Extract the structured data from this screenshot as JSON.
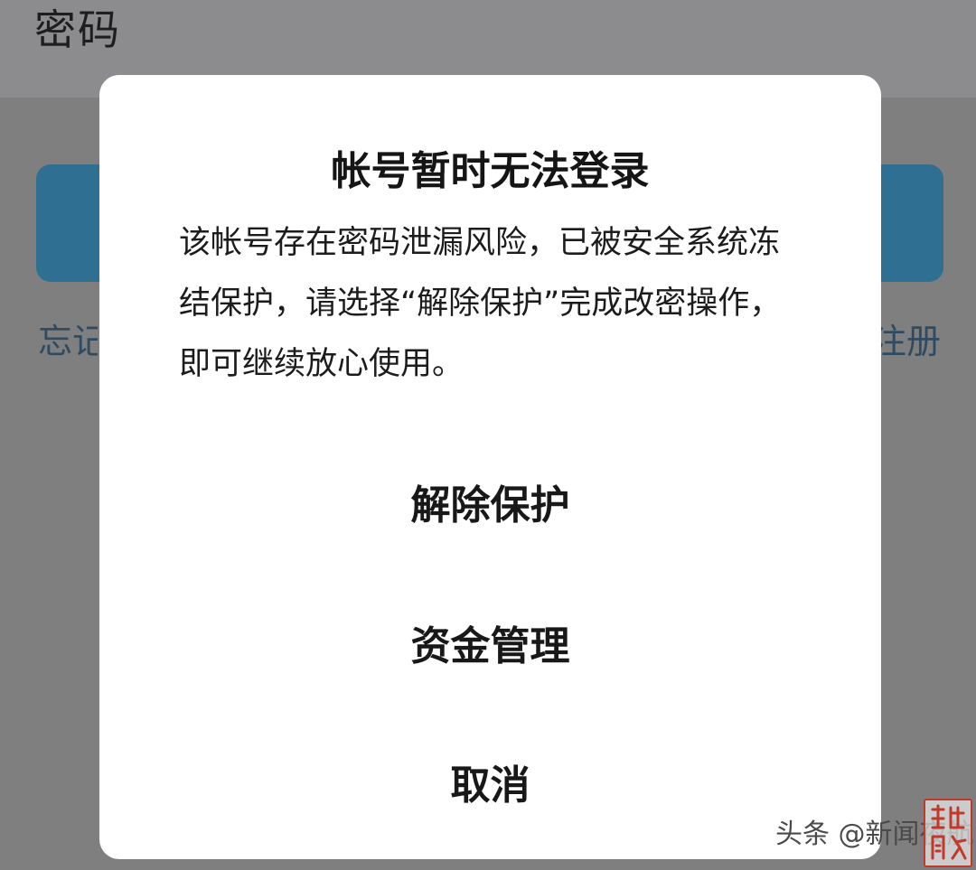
{
  "background": {
    "password_label": "密码",
    "forgot_link": "忘记",
    "register_link": "注册"
  },
  "dialog": {
    "title": "帐号暂时无法登录",
    "message": "该帐号存在密码泄漏风险，已被安全系统冻结保护，请选择“解除保护”完成改密操作，即可继续放心使用。",
    "actions": [
      {
        "label": "解除保护"
      },
      {
        "label": "资金管理"
      },
      {
        "label": "取消"
      }
    ]
  },
  "watermark": {
    "text": "头条 @新闻夜航",
    "seal_icon": "red-seal-icon"
  },
  "colors": {
    "overlay": "#7f7f80",
    "dialog_bg": "#ffffff",
    "login_button": "#2f6f91",
    "link": "#2e4b62",
    "seal": "#c0392b"
  }
}
